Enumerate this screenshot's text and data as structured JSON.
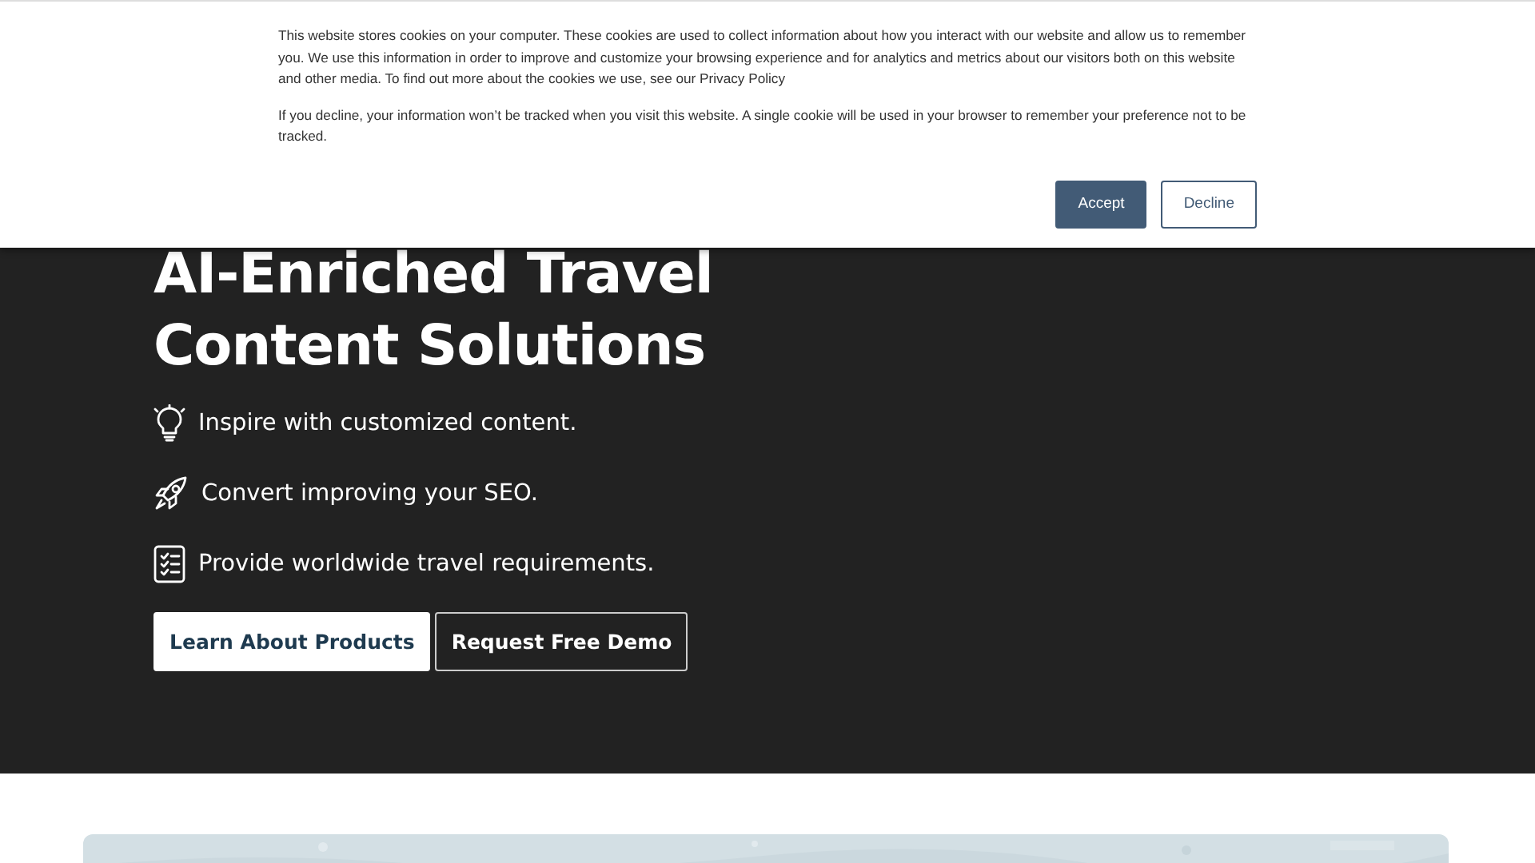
{
  "hero": {
    "heading_lines": [
      "AI-Enriched Travel",
      "Content Solutions"
    ],
    "features": [
      {
        "kind": "bulb",
        "text": "Inspire with customized content."
      },
      {
        "kind": "rocket",
        "text": "Convert improving your SEO."
      },
      {
        "kind": "checklist",
        "text": "Provide worldwide travel requirements."
      }
    ],
    "buttons": [
      {
        "label": "Learn About Products",
        "kind": "primary"
      },
      {
        "label": "Request Free Demo",
        "kind": "outline"
      }
    ]
  },
  "cookie_banner": {
    "paragraphs": [
      "This website stores cookies on your computer. These cookies are used to collect information about how you interact with our website and allow us to remember you. We use this information in order to improve and customize your browsing experience and for analytics and metrics about our visitors both on this website and other media. To find out more about the cookies we use, see our Privacy Policy",
      "If you decline, your information won’t be tracked when you visit this website. A single cookie will be used in your browser to remember your preference not to be tracked."
    ],
    "buttons": [
      {
        "label": "Accept",
        "kind": "primary"
      },
      {
        "label": "Decline",
        "kind": "outline"
      }
    ]
  }
}
